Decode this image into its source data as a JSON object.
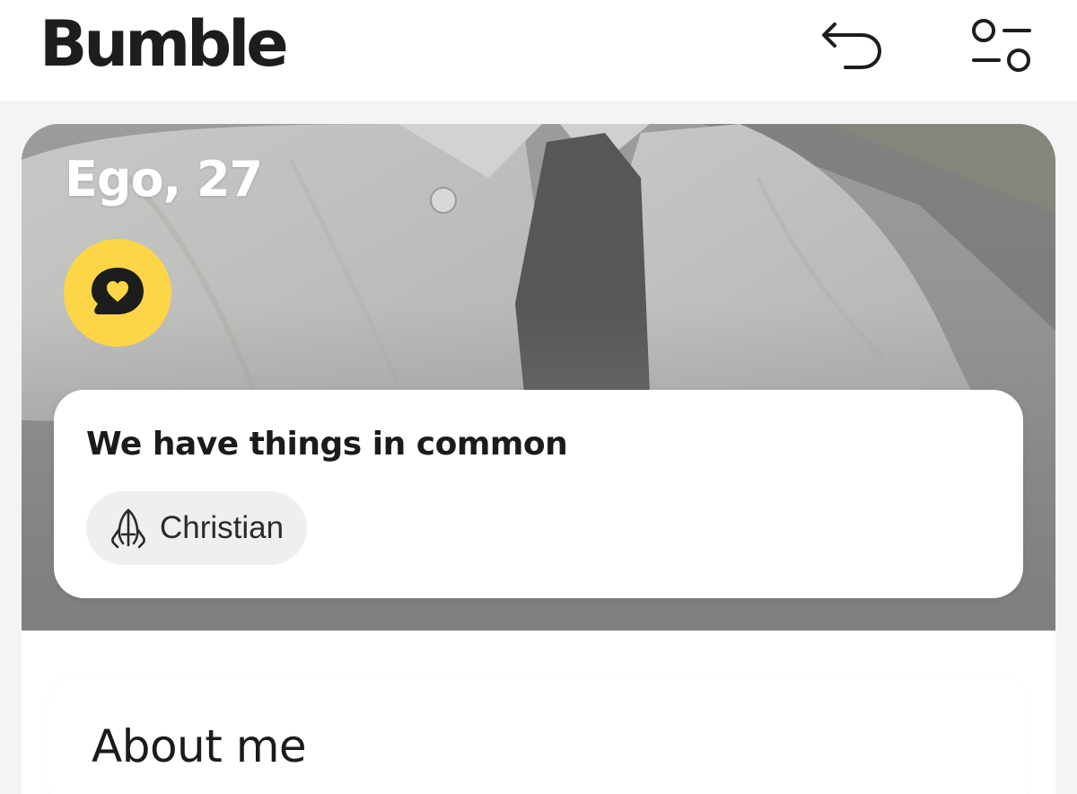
{
  "header": {
    "brand": "Bumble",
    "undo_icon": "undo-icon",
    "filter_icon": "filter-sliders-icon"
  },
  "profile": {
    "name_age": "Ego, 27",
    "badge_icon": "chat-heart-icon",
    "badge_color": "#fdd648"
  },
  "common": {
    "title": "We have things in common",
    "chips": [
      {
        "icon": "praying-hands-icon",
        "label": "Christian"
      }
    ]
  },
  "about": {
    "title": "About me"
  }
}
